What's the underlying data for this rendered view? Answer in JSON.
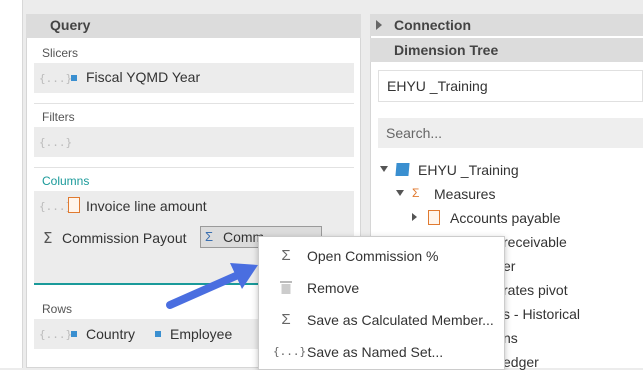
{
  "query": {
    "title": "Query",
    "slicers": {
      "label": "Slicers",
      "items": [
        "Fiscal YQMD Year"
      ]
    },
    "filters": {
      "label": "Filters"
    },
    "columns": {
      "label": "Columns",
      "items": [
        "Invoice line amount",
        "Commission Payout",
        "Comm"
      ]
    },
    "rows": {
      "label": "Rows",
      "items": [
        "Country",
        "Employee"
      ]
    }
  },
  "right": {
    "connection_title": "Connection",
    "dimension_tree_title": "Dimension Tree",
    "cube_name": "EHYU _Training",
    "search_placeholder": "Search...",
    "tree": {
      "root": "EHYU _Training",
      "measures": "Measures",
      "items": [
        "Accounts payable",
        "receivable",
        "er",
        "rates pivot",
        "s - Historical",
        "ns",
        "edger"
      ]
    }
  },
  "context_menu": {
    "items": [
      {
        "label": "Open Commission %",
        "icon": "sigma-icon"
      },
      {
        "label": "Remove",
        "icon": "trash-icon"
      },
      {
        "label": "Save as Calculated Member...",
        "icon": "sigma-icon"
      },
      {
        "label": "Save as Named Set...",
        "icon": "named-set-icon"
      }
    ]
  },
  "colors": {
    "accent": "#1a9a9a",
    "arrow": "#4a6ee0",
    "member": "#3a8fd0"
  }
}
